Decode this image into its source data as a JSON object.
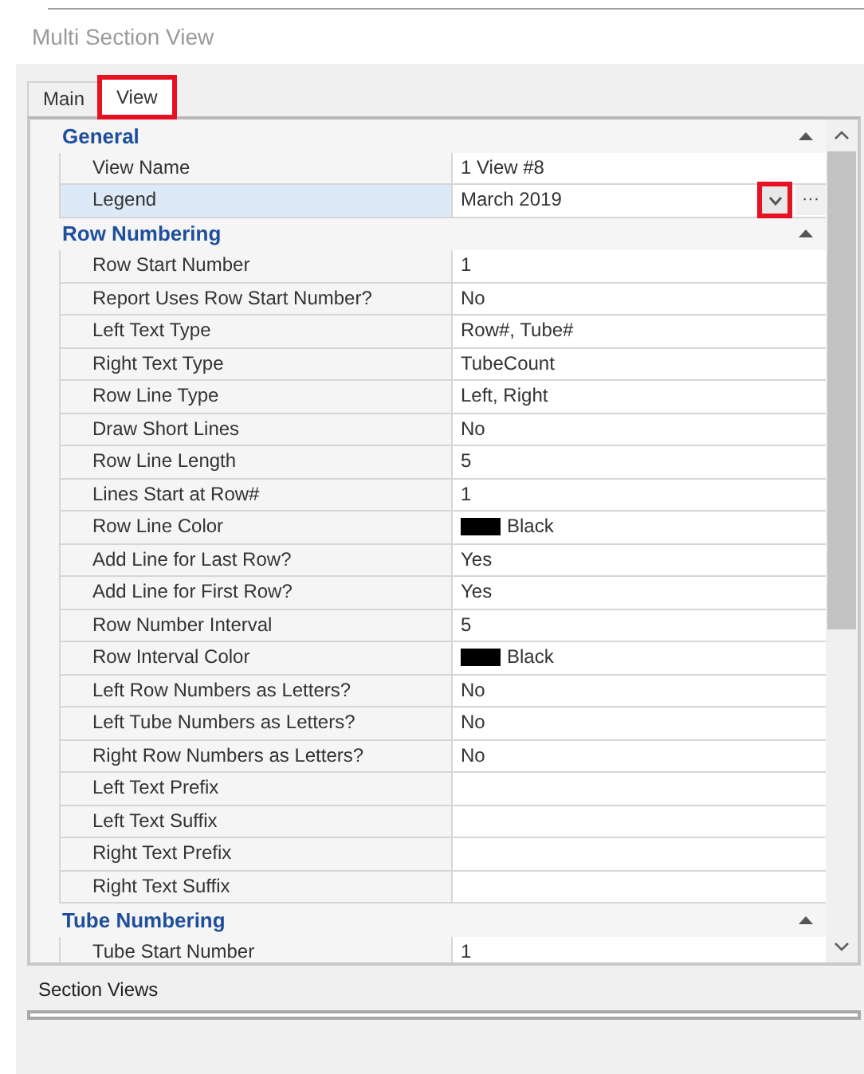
{
  "window": {
    "title": "Multi Section View"
  },
  "tabs": [
    {
      "label": "Main",
      "selected": false,
      "highlighted": false
    },
    {
      "label": "View",
      "selected": true,
      "highlighted": true
    }
  ],
  "sections": [
    {
      "title": "General",
      "expanded": true,
      "rows": [
        {
          "kind": "text",
          "name": "View Name",
          "value": "1 View #8",
          "selected": false
        },
        {
          "kind": "dropdown",
          "name": "Legend",
          "value": "March 2019",
          "selected": true,
          "highlighted": true,
          "ellipsis": "···"
        }
      ]
    },
    {
      "title": "Row Numbering",
      "expanded": true,
      "rows": [
        {
          "kind": "text",
          "name": "Row Start Number",
          "value": "1",
          "selected": false
        },
        {
          "kind": "text",
          "name": "Report Uses Row Start Number?",
          "value": "No",
          "selected": false
        },
        {
          "kind": "text",
          "name": "Left Text Type",
          "value": "Row#, Tube#",
          "selected": false
        },
        {
          "kind": "text",
          "name": "Right Text Type",
          "value": "TubeCount",
          "selected": false
        },
        {
          "kind": "text",
          "name": "Row Line Type",
          "value": "Left, Right",
          "selected": false
        },
        {
          "kind": "text",
          "name": "Draw Short Lines",
          "value": "No",
          "selected": false
        },
        {
          "kind": "text",
          "name": "Row Line Length",
          "value": "5",
          "selected": false
        },
        {
          "kind": "text",
          "name": "Lines Start at Row#",
          "value": "1",
          "selected": false
        },
        {
          "kind": "color",
          "name": "Row Line Color",
          "value": "Black",
          "color": "#000000",
          "selected": false
        },
        {
          "kind": "text",
          "name": "Add Line for Last Row?",
          "value": "Yes",
          "selected": false
        },
        {
          "kind": "text",
          "name": "Add Line for First Row?",
          "value": "Yes",
          "selected": false
        },
        {
          "kind": "text",
          "name": "Row Number Interval",
          "value": "5",
          "selected": false
        },
        {
          "kind": "color",
          "name": "Row Interval Color",
          "value": "Black",
          "color": "#000000",
          "selected": false
        },
        {
          "kind": "text",
          "name": "Left Row Numbers as Letters?",
          "value": "No",
          "selected": false
        },
        {
          "kind": "text",
          "name": "Left Tube Numbers as Letters?",
          "value": "No",
          "selected": false
        },
        {
          "kind": "text",
          "name": "Right Row Numbers as Letters?",
          "value": "No",
          "selected": false
        },
        {
          "kind": "text",
          "name": "Left Text Prefix",
          "value": "",
          "selected": false
        },
        {
          "kind": "text",
          "name": "Left Text Suffix",
          "value": "",
          "selected": false
        },
        {
          "kind": "text",
          "name": "Right Text Prefix",
          "value": "",
          "selected": false
        },
        {
          "kind": "text",
          "name": "Right Text Suffix",
          "value": "",
          "selected": false
        }
      ]
    },
    {
      "title": "Tube Numbering",
      "expanded": true,
      "rows": [
        {
          "kind": "text",
          "name": "Tube Start Number",
          "value": "1",
          "selected": false
        }
      ]
    }
  ],
  "group": {
    "title": "Section Views"
  }
}
